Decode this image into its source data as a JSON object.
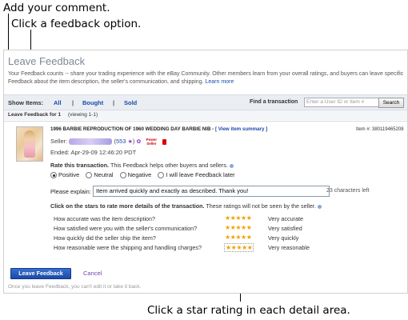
{
  "callouts": {
    "comment": "Add your comment.",
    "option": "Click a feedback option.",
    "star": "Click a star rating in each detail area."
  },
  "page": {
    "title": "Leave Feedback",
    "intro": "Your Feedback counts -- share your trading experience with the eBay Community. Other members learn from your overall ratings, and buyers can leave specific Feedback about the item description, the seller's communication, and shipping.",
    "learn_more": "Learn more"
  },
  "filter": {
    "show_items_label": "Show Items:",
    "all": "All",
    "bought": "Bought",
    "sold": "Sold",
    "find_label": "Find a transaction",
    "find_placeholder": "Enter a User ID or Item #",
    "search_button": "Search"
  },
  "subheader": {
    "title": "Leave Feedback for 1",
    "viewing": "(viewing 1-1)"
  },
  "item": {
    "title": "1996 BARBIE REPRODUCTION OF 1960 WEDDING DAY BARBIE NIB -",
    "view_summary": "[ View item summary ]",
    "item_number": "Item #: 380119465208",
    "seller_label": "Seller:",
    "seller_score": "553",
    "power_seller": "Power Seller",
    "ended": "Ended: Apr-29-09 12:46:20 PDT"
  },
  "rating": {
    "label": "Rate this transaction.",
    "help": "This Feedback helps other buyers and sellers.",
    "options": [
      "Positive",
      "Neutral",
      "Negative",
      "I will leave Feedback later"
    ],
    "selected": "Positive"
  },
  "explain": {
    "label": "Please explain:",
    "value": "Item arrived quickly and exactly as described. Thank you!",
    "chars_left": "23 characters left"
  },
  "details": {
    "header_bold": "Click on the stars to rate more details of the transaction.",
    "header_note": "These ratings will not be seen by the seller.",
    "rows": [
      {
        "question": "How accurate was the item description?",
        "stars": 5,
        "value": "Very accurate"
      },
      {
        "question": "How satisfied were you with the seller's communication?",
        "stars": 5,
        "value": "Very satisfied"
      },
      {
        "question": "How quickly did the seller ship the item?",
        "stars": 5,
        "value": "Very quickly"
      },
      {
        "question": "How reasonable were the shipping and handling charges?",
        "stars": 5,
        "value": "Very reasonable"
      }
    ]
  },
  "actions": {
    "leave_button": "Leave Feedback",
    "cancel": "Cancel",
    "footnote": "Once you leave Feedback, you can't edit it or take it back."
  },
  "colors": {
    "star": "#f0a000",
    "link": "#1a4aa8",
    "button": "#1a4aa8"
  }
}
